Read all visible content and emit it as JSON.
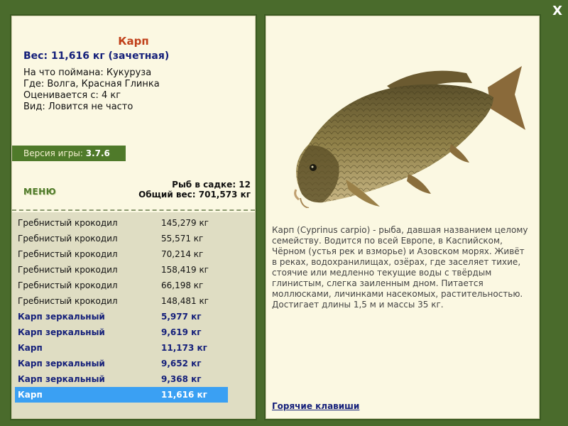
{
  "window": {
    "close_label": "X"
  },
  "fish": {
    "name": "Карп",
    "weight_line": "Вес: 11,616 кг (зачетная)",
    "bait": "На что поймана: Кукуруза",
    "location": "Где: Волга, Красная Глинка",
    "valued_from": "Оценивается с: 4 кг",
    "rarity": "Вид: Ловится не часто"
  },
  "version": {
    "label": "Версия игры:",
    "value": "3.7.6"
  },
  "menu": {
    "label": "МЕНЮ"
  },
  "keepnet": {
    "count_line": "Рыб в садке: 12",
    "total_line": "Общий вес: 701,573 кг"
  },
  "catch_list": [
    {
      "name": "Гребнистый крокодил",
      "weight": "145,279 кг",
      "style": "normal"
    },
    {
      "name": "Гребнистый крокодил",
      "weight": "55,571 кг",
      "style": "normal"
    },
    {
      "name": "Гребнистый крокодил",
      "weight": "70,214 кг",
      "style": "normal"
    },
    {
      "name": "Гребнистый крокодил",
      "weight": "158,419 кг",
      "style": "normal"
    },
    {
      "name": "Гребнистый крокодил",
      "weight": "66,198 кг",
      "style": "normal"
    },
    {
      "name": "Гребнистый крокодил",
      "weight": "148,481 кг",
      "style": "normal"
    },
    {
      "name": "Карп зеркальный",
      "weight": "5,977 кг",
      "style": "trophy"
    },
    {
      "name": "Карп зеркальный",
      "weight": "9,619 кг",
      "style": "trophy"
    },
    {
      "name": "Карп",
      "weight": "11,173 кг",
      "style": "trophy"
    },
    {
      "name": "Карп зеркальный",
      "weight": "9,652 кг",
      "style": "trophy"
    },
    {
      "name": "Карп зеркальный",
      "weight": "9,368 кг",
      "style": "trophy"
    },
    {
      "name": "Карп",
      "weight": "11,616 кг",
      "style": "selected"
    }
  ],
  "description": "Карп (Cyprinus carpio) - рыба, давшая названием целому семейству. Водится по всей Европе, в Каспийском, Чёрном (устья рек и взморье) и Азовском морях. Живёт в реках, водохранилищах, озёрах, где заселяет тихие, стоячие или медленно текущие воды с твёрдым глинистым, слегка заиленным дном. Питается моллюсками, личинками насекомых, растительностью. Достигает длины 1,5 м и массы 35 кг.",
  "hotkeys": {
    "label": "Горячие клавиши"
  }
}
